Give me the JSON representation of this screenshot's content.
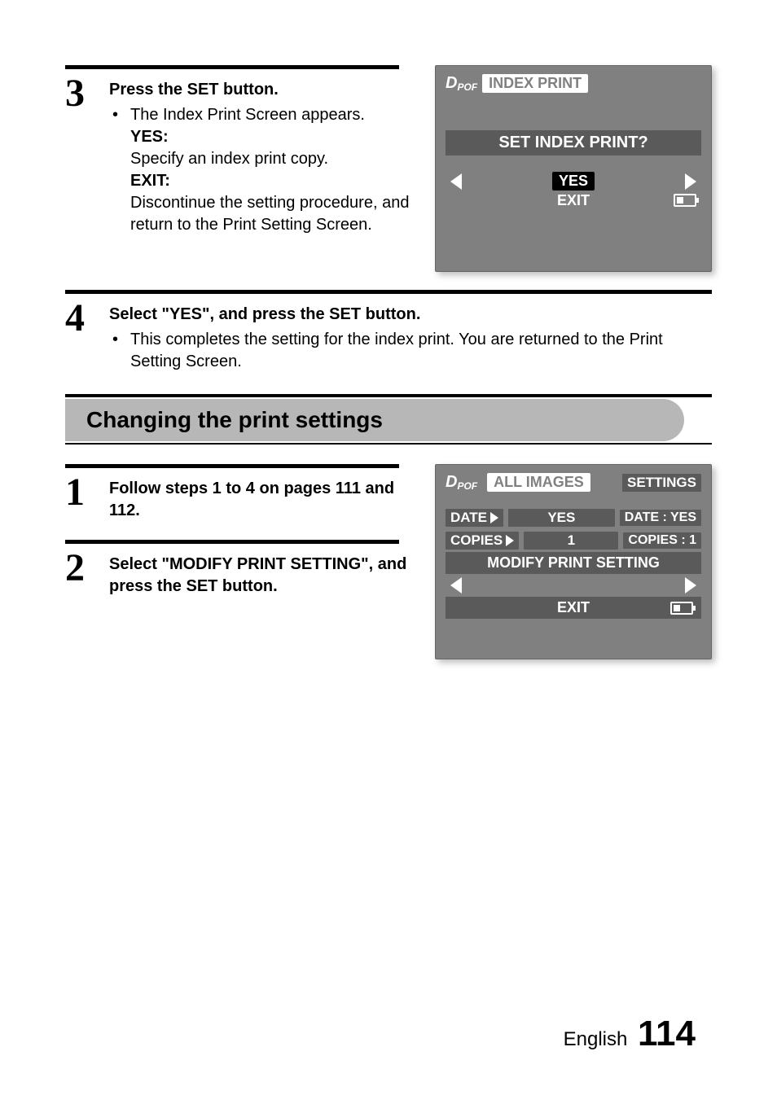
{
  "step3": {
    "title": "Press the SET button.",
    "bullet1": "The Index Print Screen appears.",
    "yes_label": "YES:",
    "yes_desc": "Specify an index print copy.",
    "exit_label": "EXIT:",
    "exit_desc": "Discontinue the setting procedure, and return to the Print Setting Screen."
  },
  "screen1": {
    "dpof_d": "D",
    "dpof_rest": "POF",
    "title": "INDEX PRINT",
    "question": "SET INDEX PRINT?",
    "yes": "YES",
    "exit": "EXIT"
  },
  "step4": {
    "title": "Select \"YES\", and press the SET button.",
    "bullet1": "This completes the setting for the index print. You are returned to the Print Setting Screen."
  },
  "section_title": "Changing the print settings",
  "step1b": {
    "title": "Follow steps 1 to 4 on pages 111 and 112."
  },
  "step2b": {
    "title": "Select \"MODIFY PRINT SETTING\", and press the SET button."
  },
  "screen2": {
    "dpof_d": "D",
    "dpof_rest": "POF",
    "all_images": "ALL IMAGES",
    "settings": "SETTINGS",
    "date_label": "DATE",
    "date_value": "YES",
    "date_status": "DATE : YES",
    "copies_label": "COPIES",
    "copies_value": "1",
    "copies_status": "COPIES : 1",
    "modify": "MODIFY PRINT SETTING",
    "exit": "EXIT"
  },
  "footer": {
    "lang": "English",
    "page": "114"
  }
}
